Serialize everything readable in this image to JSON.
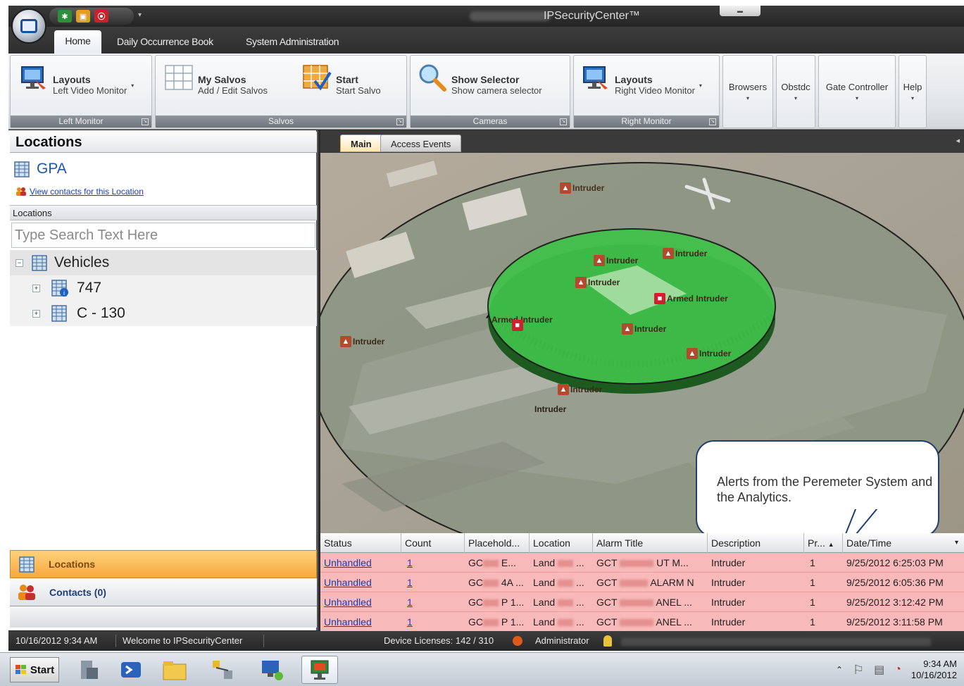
{
  "window": {
    "title": "IPSecurityCenter™",
    "ribbon_tabs": [
      "Home",
      "Daily Occurrence Book",
      "System Administration"
    ]
  },
  "ribbon": {
    "left_monitor": {
      "t1": "Layouts",
      "t2": "Left Video Monitor",
      "group": "Left Monitor"
    },
    "salvos": {
      "my": {
        "t1": "My Salvos",
        "t2": "Add / Edit Salvos"
      },
      "start": {
        "t1": "Start",
        "t2": "Start Salvo"
      },
      "group": "Salvos"
    },
    "cameras": {
      "t1": "Show Selector",
      "t2": "Show camera selector",
      "group": "Cameras"
    },
    "right_monitor": {
      "t1": "Layouts",
      "t2": "Right Video Monitor",
      "group": "Right Monitor"
    },
    "extras": [
      "Browsers",
      "Obstdc",
      "Gate Controller",
      "Help"
    ]
  },
  "left": {
    "title": "Locations",
    "location_name": "GPA",
    "contacts_link": "View contacts for this Location",
    "sub_header": "Locations",
    "search_placeholder": "Type Search Text Here",
    "tree": {
      "root": "Vehicles",
      "children": [
        "747",
        "C - 130"
      ]
    },
    "nav": {
      "locations": "Locations",
      "contacts": "Contacts (0)"
    }
  },
  "doc_tabs": [
    "Main",
    "Access Events"
  ],
  "map": {
    "markers": [
      {
        "label": "Intruder",
        "kind": "alert"
      },
      {
        "label": "Intruder",
        "kind": "alert"
      },
      {
        "label": "Intruder",
        "kind": "alert"
      },
      {
        "label": "Intruder",
        "kind": "alert"
      },
      {
        "label": "Armed Intruder",
        "kind": "armed"
      },
      {
        "label": "Armed Intruder",
        "kind": "armed"
      },
      {
        "label": "Intruder",
        "kind": "alert"
      },
      {
        "label": "Intruder",
        "kind": "alert"
      },
      {
        "label": "Intruder",
        "kind": "alert"
      },
      {
        "label": "Intruder",
        "kind": "alert"
      },
      {
        "label": "Intruder",
        "kind": "text"
      }
    ],
    "callout": "Alerts from the Peremeter System and the Analytics."
  },
  "grid": {
    "columns": [
      "Status",
      "Count",
      "Placehold...",
      "Location",
      "Alarm Title",
      "Description",
      "Pr...",
      "Date/Time"
    ],
    "rows": [
      {
        "status": "Unhandled",
        "count": "1",
        "placeholder_a": "GC",
        "placeholder_b": "E...",
        "location_a": "Land",
        "location_b": "...",
        "title_a": "GCT",
        "title_b": "UT M...",
        "description": "Intruder",
        "priority": "1",
        "datetime": "9/25/2012 6:25:03 PM"
      },
      {
        "status": "Unhandled",
        "count": "1",
        "placeholder_a": "GC",
        "placeholder_b": "4A ...",
        "location_a": "Land",
        "location_b": "...",
        "title_a": "GCT",
        "title_b": "ALARM N",
        "description": "Intruder",
        "priority": "1",
        "datetime": "9/25/2012 6:05:36 PM"
      },
      {
        "status": "Unhandled",
        "count": "1",
        "placeholder_a": "GC",
        "placeholder_b": "P 1...",
        "location_a": "Land",
        "location_b": "...",
        "title_a": "GCT",
        "title_b": "ANEL ...",
        "description": "Intruder",
        "priority": "1",
        "datetime": "9/25/2012 3:12:42 PM"
      },
      {
        "status": "Unhandled",
        "count": "1",
        "placeholder_a": "GC",
        "placeholder_b": "P 1...",
        "location_a": "Land",
        "location_b": "...",
        "title_a": "GCT",
        "title_b": "ANEL ...",
        "description": "Intruder",
        "priority": "1",
        "datetime": "9/25/2012 3:11:58 PM"
      }
    ]
  },
  "statusbar": {
    "datetime": "10/16/2012 9:34 AM",
    "welcome": "Welcome to IPSecurityCenter",
    "licenses": "Device Licenses: 142 / 310",
    "user": "Administrator"
  },
  "taskbar": {
    "start": "Start",
    "clock_time": "9:34 AM",
    "clock_date": "10/16/2012"
  },
  "colors": {
    "alarm_row": "#f7b9b9",
    "perimeter_zone": "#3fc24a",
    "nav_active": "#f7a83e"
  }
}
